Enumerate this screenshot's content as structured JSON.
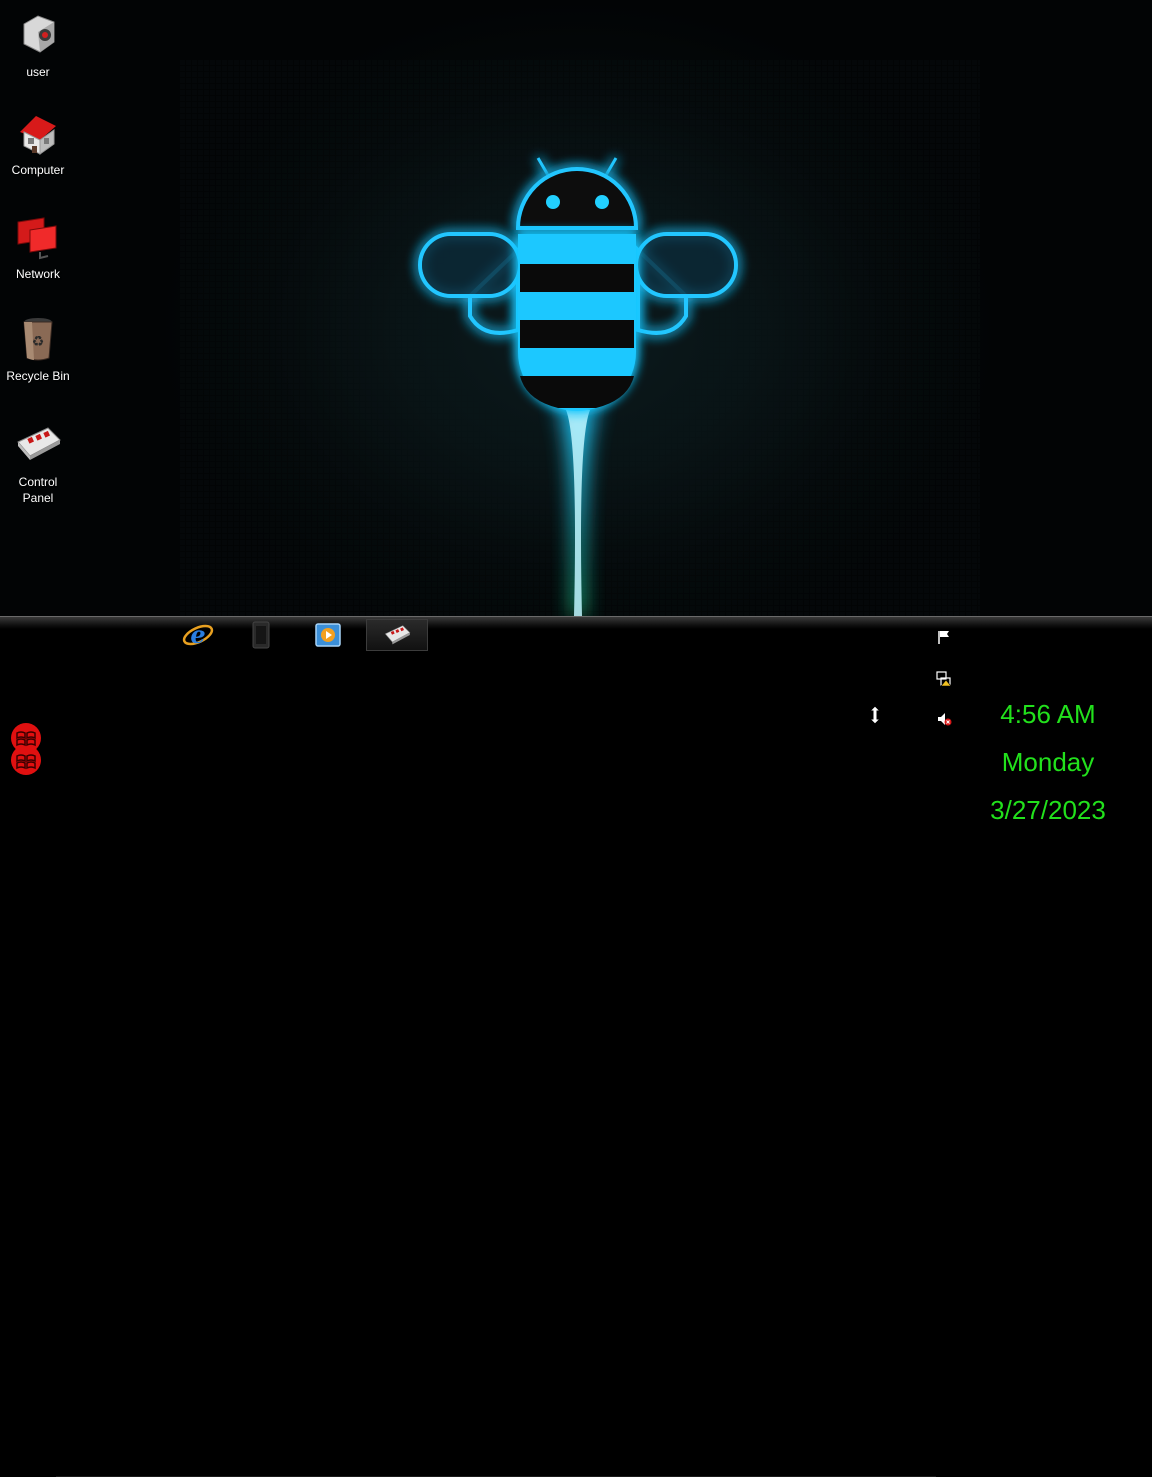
{
  "desktop": {
    "icons": [
      {
        "label": "user",
        "icon": "user-folder-icon"
      },
      {
        "label": "Computer",
        "icon": "computer-house-icon"
      },
      {
        "label": "Network",
        "icon": "network-icon"
      },
      {
        "label": "Recycle Bin",
        "icon": "recycle-bin-icon"
      },
      {
        "label": "Control Panel",
        "icon": "control-panel-icon"
      }
    ],
    "wallpaper": "android-honeycomb-bee",
    "colors": {
      "glow": "#1ec8ff",
      "stripe": "#0a0a0a"
    }
  },
  "taskbar": {
    "pinned": [
      {
        "icon": "internet-explorer-icon"
      },
      {
        "icon": "generic-window-icon"
      },
      {
        "icon": "media-player-icon"
      },
      {
        "icon": "control-panel-icon",
        "active": true
      }
    ],
    "tray": [
      "flag-icon",
      "network-warning-icon",
      "speaker-muted-icon"
    ],
    "clock": {
      "time": "4:56 AM",
      "day": "Monday",
      "date": "3/27/2023",
      "color": "#22e11c"
    },
    "start_orb_color": "#e01010"
  }
}
